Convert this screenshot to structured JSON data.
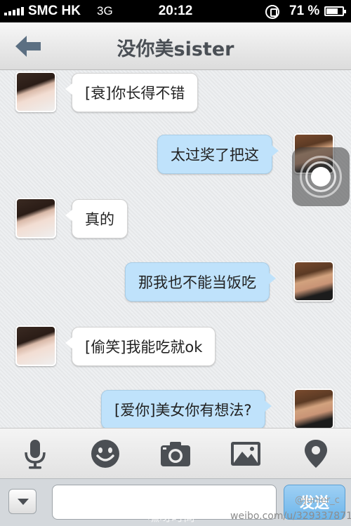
{
  "status_bar": {
    "carrier": "SMC HK",
    "network": "3G",
    "time": "20:12",
    "battery_percent": "71 %",
    "battery_level": 0.71,
    "signal_bars": 5
  },
  "nav": {
    "back_icon": "back-arrow-icon",
    "title": "没你美sister"
  },
  "messages": [
    {
      "side": "left",
      "text": "[衰]你长得不错"
    },
    {
      "side": "right",
      "text": "太过奖了把这"
    },
    {
      "side": "left",
      "text": "真的"
    },
    {
      "side": "right",
      "text": "那我也不能当饭吃"
    },
    {
      "side": "left",
      "text": "[偷笑]我能吃就ok"
    },
    {
      "side": "right",
      "text": "[爱你]美女你有想法?"
    }
  ],
  "toolbar": {
    "icons": [
      "microphone-icon",
      "emoji-icon",
      "camera-icon",
      "image-icon",
      "location-icon"
    ]
  },
  "input_bar": {
    "message_value": "",
    "send_label": "发送"
  },
  "watermark": {
    "site": "HEIYA.CN",
    "site_cn": "嘿呀时尚",
    "weibo_handle": "@Junier_c",
    "weibo_url": "weibo.com/u/3293378714"
  },
  "colors": {
    "outgoing_bubble": "#bfe2fb",
    "incoming_bubble": "#ffffff",
    "send_button": "#6fb6ea"
  }
}
